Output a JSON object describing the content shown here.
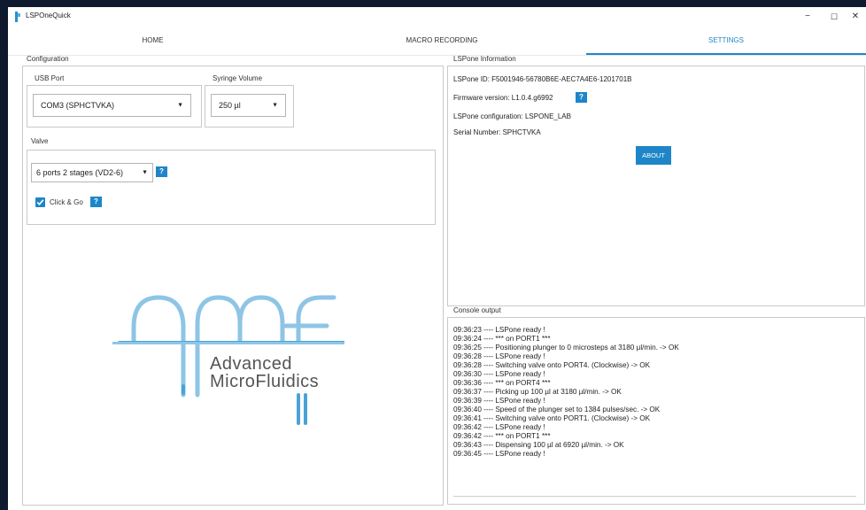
{
  "window": {
    "title": "LSPOneQuick",
    "minimize_icon": "minimize-icon",
    "maximize_icon": "maximize-icon",
    "close_icon": "close-icon",
    "minimize_glyph": "−",
    "maximize_glyph": "☐",
    "close_glyph": "✕"
  },
  "tabs": [
    {
      "label": "HOME"
    },
    {
      "label": "MACRO RECORDING"
    },
    {
      "label": "SETTINGS",
      "active": true
    }
  ],
  "configuration": {
    "title": "Configuration",
    "usb_port_label": "USB Port",
    "usb_port_value": "COM3 (SPHCTVKA)",
    "syringe_volume_label": "Syringe Volume",
    "syringe_volume_value": "250 µl",
    "valve_label": "Valve",
    "valve_value": "6 ports 2 stages (VD2-6)",
    "click_go_label": "Click & Go",
    "click_go_checked": true,
    "help_glyph": "?"
  },
  "logo": {
    "line1": "Advanced",
    "line2": "MicroFluidics"
  },
  "info": {
    "title": "LSPone Information",
    "id": "LSPone ID: F5001946-56780B6E-AEC7A4E6-1201701B",
    "firmware": "Firmware version: L1.0.4.g6992",
    "configuration": "LSPone configuration: LSPONE_LAB",
    "serial": "Serial Number: SPHCTVKA",
    "about_label": "ABOUT"
  },
  "console": {
    "title": "Console output",
    "lines": [
      "09:36:23 ---- LSPone ready !",
      "09:36:24 ---- *** on PORT1 ***",
      "09:36:25 ---- Positioning plunger to 0 microsteps at 3180 µl/min. -> OK",
      "09:36:28 ---- LSPone ready !",
      "09:36:28 ---- Switching valve onto PORT4. (Clockwise) -> OK",
      "09:36:30 ---- LSPone ready !",
      "09:36:36 ---- *** on PORT4 ***",
      "09:36:37 ---- Picking up 100 µl at 3180 µl/min. -> OK",
      "09:36:39 ---- LSPone ready !",
      "09:36:40 ---- Speed of the plunger set to 1384 pulses/sec. -> OK",
      "09:36:41 ---- Switching valve onto PORT1. (Clockwise) -> OK",
      "09:36:42 ---- LSPone ready !",
      "09:36:42 ---- *** on PORT1 ***",
      "09:36:43 ---- Dispensing 100 µl at 6920 µl/min. -> OK",
      "09:36:45 ---- LSPone ready !"
    ]
  },
  "colors": {
    "accent": "#1e86c8",
    "logo_blue": "#8ec5e6",
    "logo_blue_dark": "#4aa3d8"
  }
}
